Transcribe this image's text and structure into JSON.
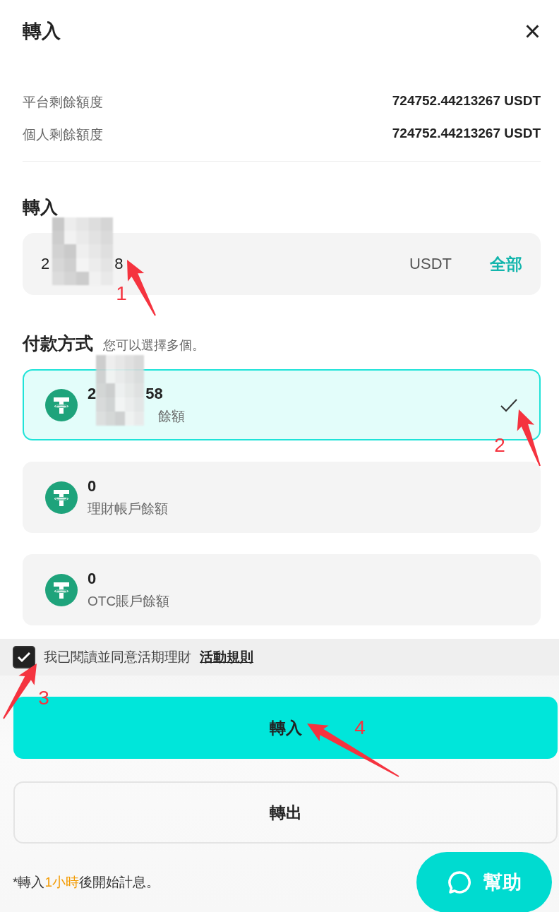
{
  "header": {
    "title": "轉入",
    "close": "×"
  },
  "limits": [
    {
      "label": "平台剩餘額度",
      "value": "724752.44213267 USDT"
    },
    {
      "label": "個人剩餘額度",
      "value": "724752.44213267 USDT"
    }
  ],
  "amount": {
    "heading": "轉入",
    "value_start": "2",
    "value_end": "8",
    "unit": "USDT",
    "all_link": "全部"
  },
  "payment": {
    "heading": "付款方式",
    "hint": "您可以選擇多個。",
    "options": [
      {
        "amount_start": "2",
        "amount_end": "58",
        "label": "餘額",
        "redacted": true,
        "selected": true
      },
      {
        "amount": "0",
        "label": "理財帳戶餘額",
        "redacted": false,
        "selected": false
      },
      {
        "amount": "0",
        "label": "OTC賬戶餘額",
        "redacted": false,
        "selected": false
      }
    ]
  },
  "agreement": {
    "checked": true,
    "text": "我已閱讀並同意活期理財",
    "link": "活動規則"
  },
  "buttons": [
    {
      "label": "轉入",
      "kind": "primary"
    },
    {
      "label": "轉出",
      "kind": "secondary"
    }
  ],
  "note": {
    "before": "*轉入",
    "highlight": "1小時",
    "after": "後開始計息。"
  },
  "help_button": "幫助",
  "annotations": [
    {
      "label": "1"
    },
    {
      "label": "2"
    },
    {
      "label": "3"
    },
    {
      "label": "4"
    }
  ]
}
